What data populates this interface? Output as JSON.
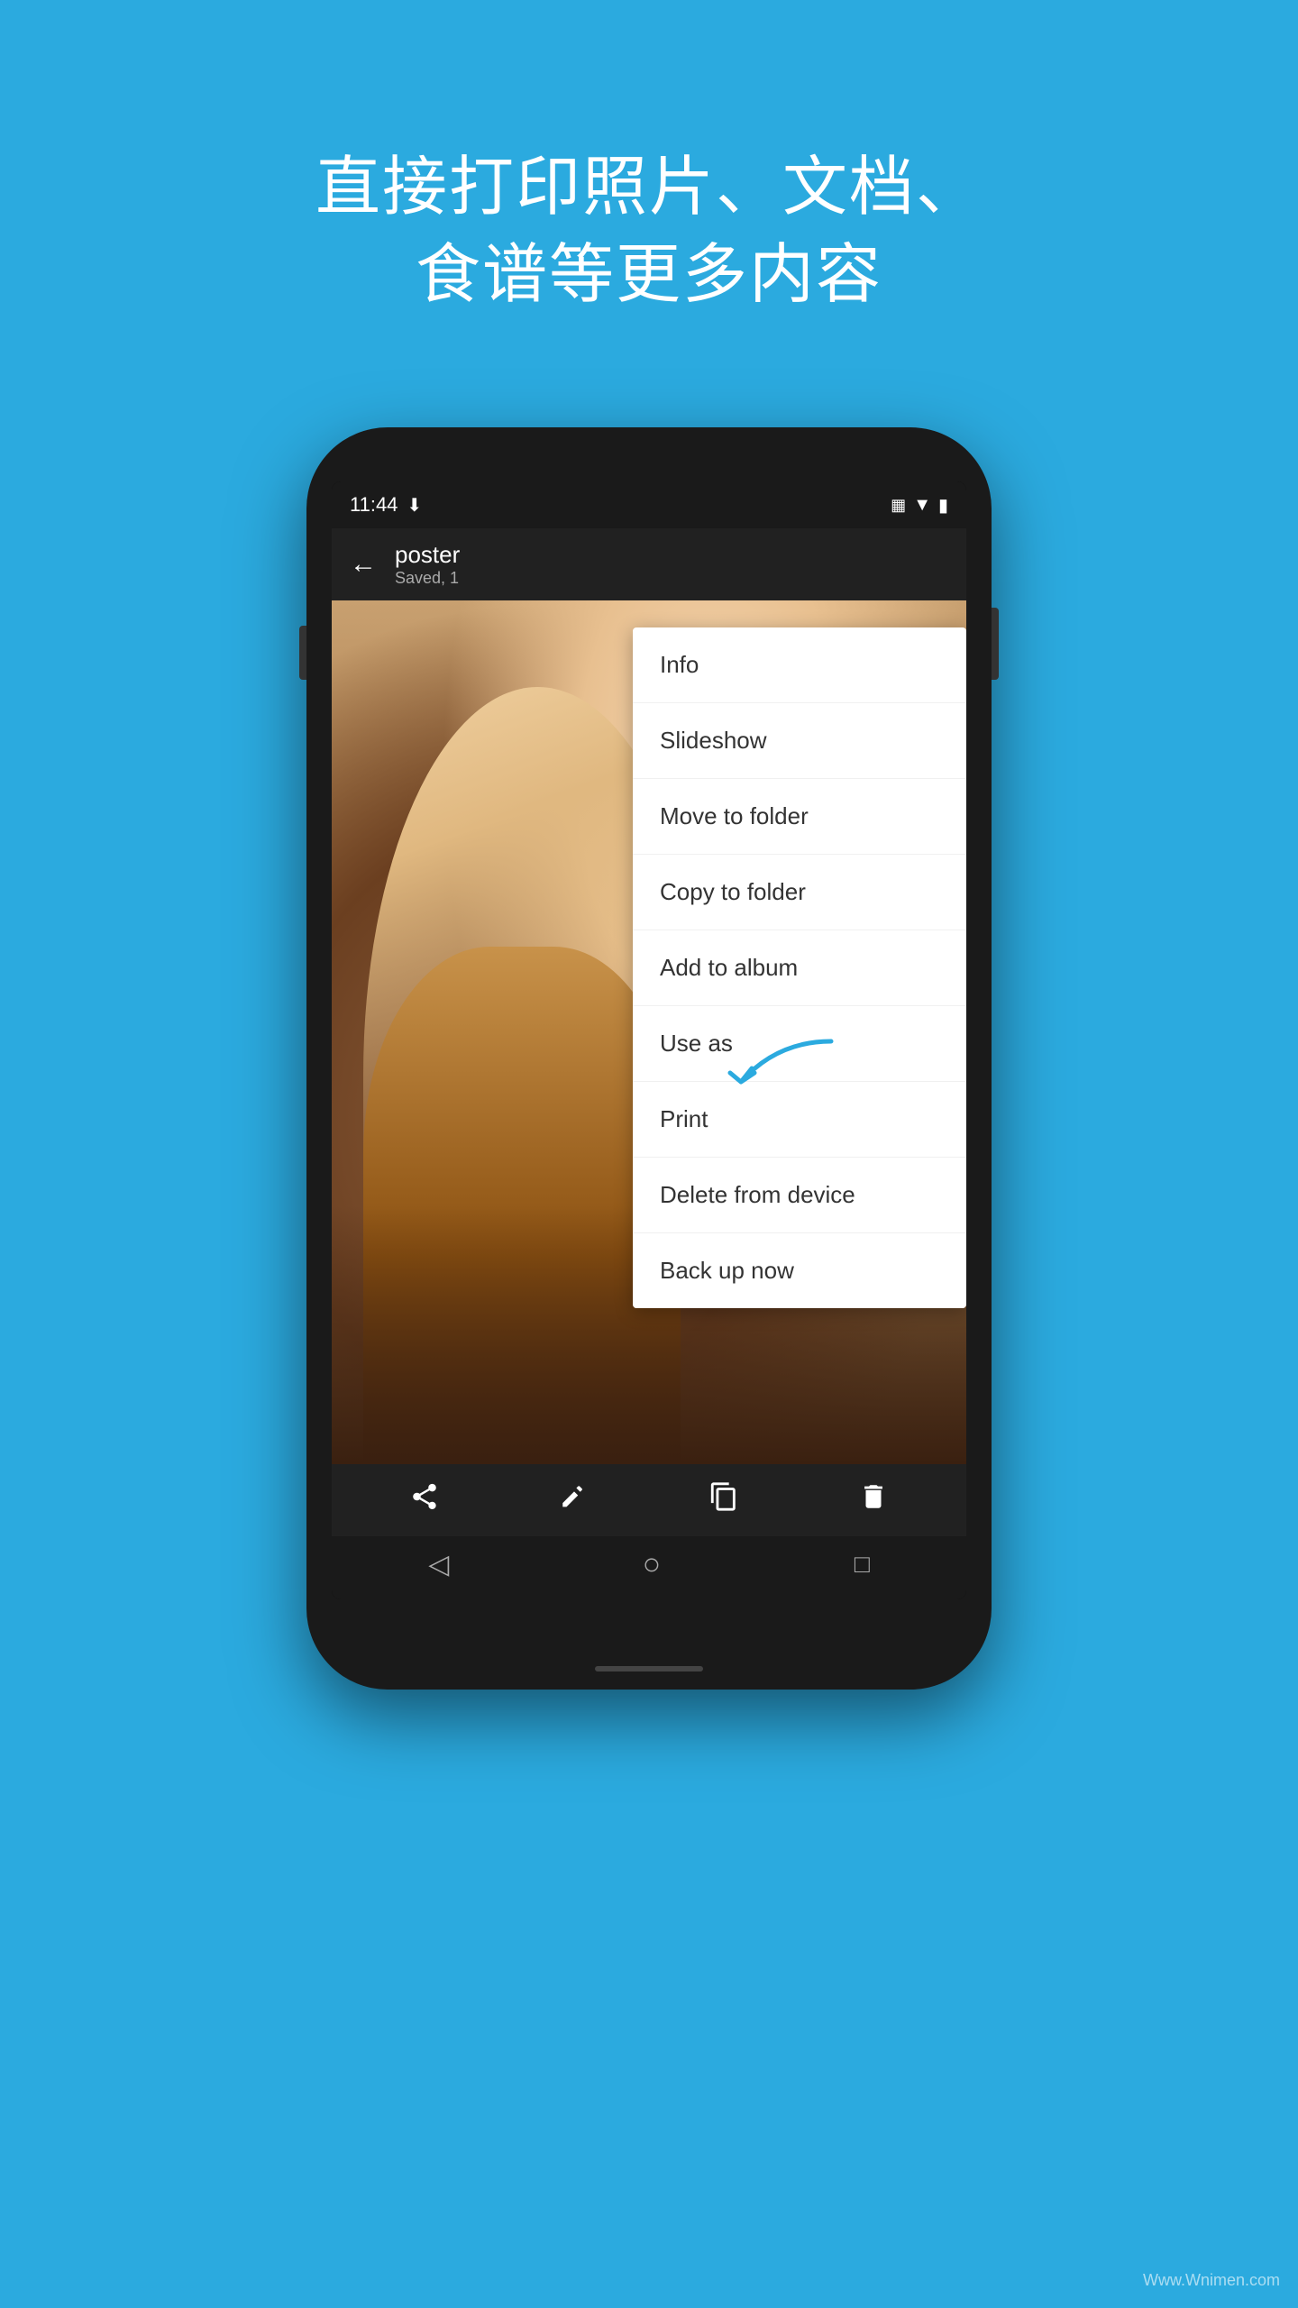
{
  "page": {
    "background_color": "#2BAADF",
    "headline_line1": "直接打印照片、文档、",
    "headline_line2": "食谱等更多内容"
  },
  "status_bar": {
    "time": "11:44",
    "download_icon": "⬇",
    "vibrate_icon": "📳",
    "wifi_icon": "▼",
    "battery_icon": "🔋"
  },
  "app_bar": {
    "back_label": "←",
    "title": "poster",
    "subtitle": "Saved, 1"
  },
  "context_menu": {
    "items": [
      {
        "label": "Info"
      },
      {
        "label": "Slideshow"
      },
      {
        "label": "Move to folder"
      },
      {
        "label": "Copy to folder"
      },
      {
        "label": "Add to album"
      },
      {
        "label": "Use as"
      },
      {
        "label": "Print"
      },
      {
        "label": "Delete from device"
      },
      {
        "label": "Back up now"
      }
    ]
  },
  "bottom_toolbar": {
    "share_icon": "share",
    "edit_icon": "tune",
    "copy_icon": "copy",
    "delete_icon": "delete"
  },
  "nav_bar": {
    "back_icon": "◁",
    "home_icon": "○",
    "recent_icon": "□"
  },
  "watermark": "Www.Wnimen.com"
}
